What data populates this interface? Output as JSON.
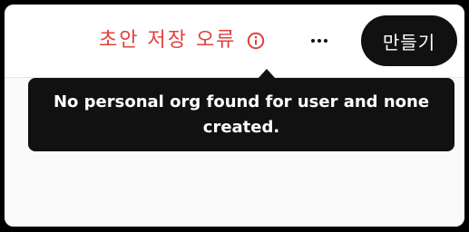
{
  "colors": {
    "error": "#e0413a",
    "button_bg": "#111111",
    "tooltip_bg": "#111111",
    "tooltip_text": "#ffffff"
  },
  "header": {
    "draft_error_label": "초안 저장 오류",
    "info_icon": "info-circle-icon",
    "more_icon": "more-horizontal-icon",
    "create_button_label": "만들기"
  },
  "tooltip": {
    "message": "No personal org found for user and none created."
  }
}
